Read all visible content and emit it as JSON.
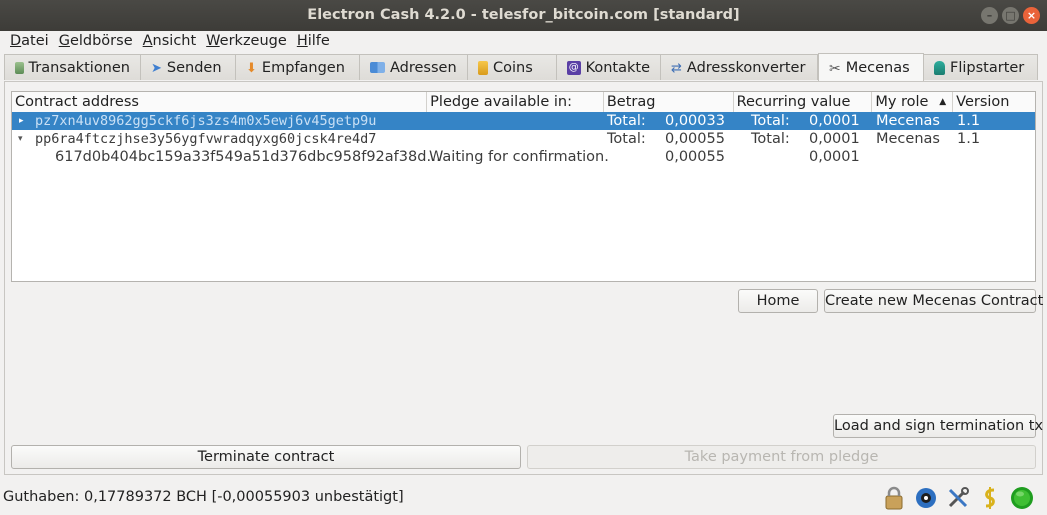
{
  "window": {
    "title": "Electron Cash 4.2.0  -  telesfor_bitcoin.com  [standard]"
  },
  "menu": [
    {
      "first": "D",
      "rest": "atei"
    },
    {
      "first": "G",
      "rest": "eldbörse"
    },
    {
      "first": "A",
      "rest": "nsicht"
    },
    {
      "first": "W",
      "rest": "erkzeuge"
    },
    {
      "first": "H",
      "rest": "ilfe"
    }
  ],
  "tabs": [
    {
      "label": "Transaktionen",
      "icon": "transactions-icon"
    },
    {
      "label": "Senden",
      "icon": "send-icon"
    },
    {
      "label": "Empfangen",
      "icon": "receive-icon"
    },
    {
      "label": "Adressen",
      "icon": "addresses-icon"
    },
    {
      "label": "Coins",
      "icon": "coins-icon"
    },
    {
      "label": "Kontakte",
      "icon": "contacts-icon"
    },
    {
      "label": "Adresskonverter",
      "icon": "converter-icon"
    },
    {
      "label": "Mecenas",
      "icon": "tools-icon"
    },
    {
      "label": "Flipstarter",
      "icon": "flipstarter-icon"
    }
  ],
  "table": {
    "columns": [
      "Contract address",
      "Pledge available in:",
      "Betrag",
      "Recurring value",
      "My role",
      "Version"
    ],
    "rows": [
      {
        "address": "pz7xn4uv8962gg5ckf6js3zs4m0x5ewj6v45getp9u",
        "pledge": "",
        "betrag_label": "Total:",
        "betrag": "0,00033",
        "recurring_label": "Total:",
        "recurring": "0,0001",
        "role": "Mecenas",
        "version": "1.1"
      },
      {
        "address": "pp6ra4ftczjhse3y56ygfvwradqyxg60jcsk4re4d7",
        "pledge": "",
        "betrag_label": "Total:",
        "betrag": "0,00055",
        "recurring_label": "Total:",
        "recurring": "0,0001",
        "role": "Mecenas",
        "version": "1.1"
      },
      {
        "address": "617d0b404bc159a33f549a51d376dbc958f92af38d…",
        "pledge": "Waiting for confirmation.",
        "betrag": "0,00055",
        "recurring": "0,0001"
      }
    ]
  },
  "buttons": {
    "home": "Home",
    "create": "Create new Mecenas Contract",
    "load_sign": "Load and sign termination tx",
    "terminate": "Terminate contract",
    "take_payment": "Take payment from pledge"
  },
  "status": {
    "balance": "Guthaben: 0,17789372 BCH [-0,00055903 unbestätigt]"
  }
}
